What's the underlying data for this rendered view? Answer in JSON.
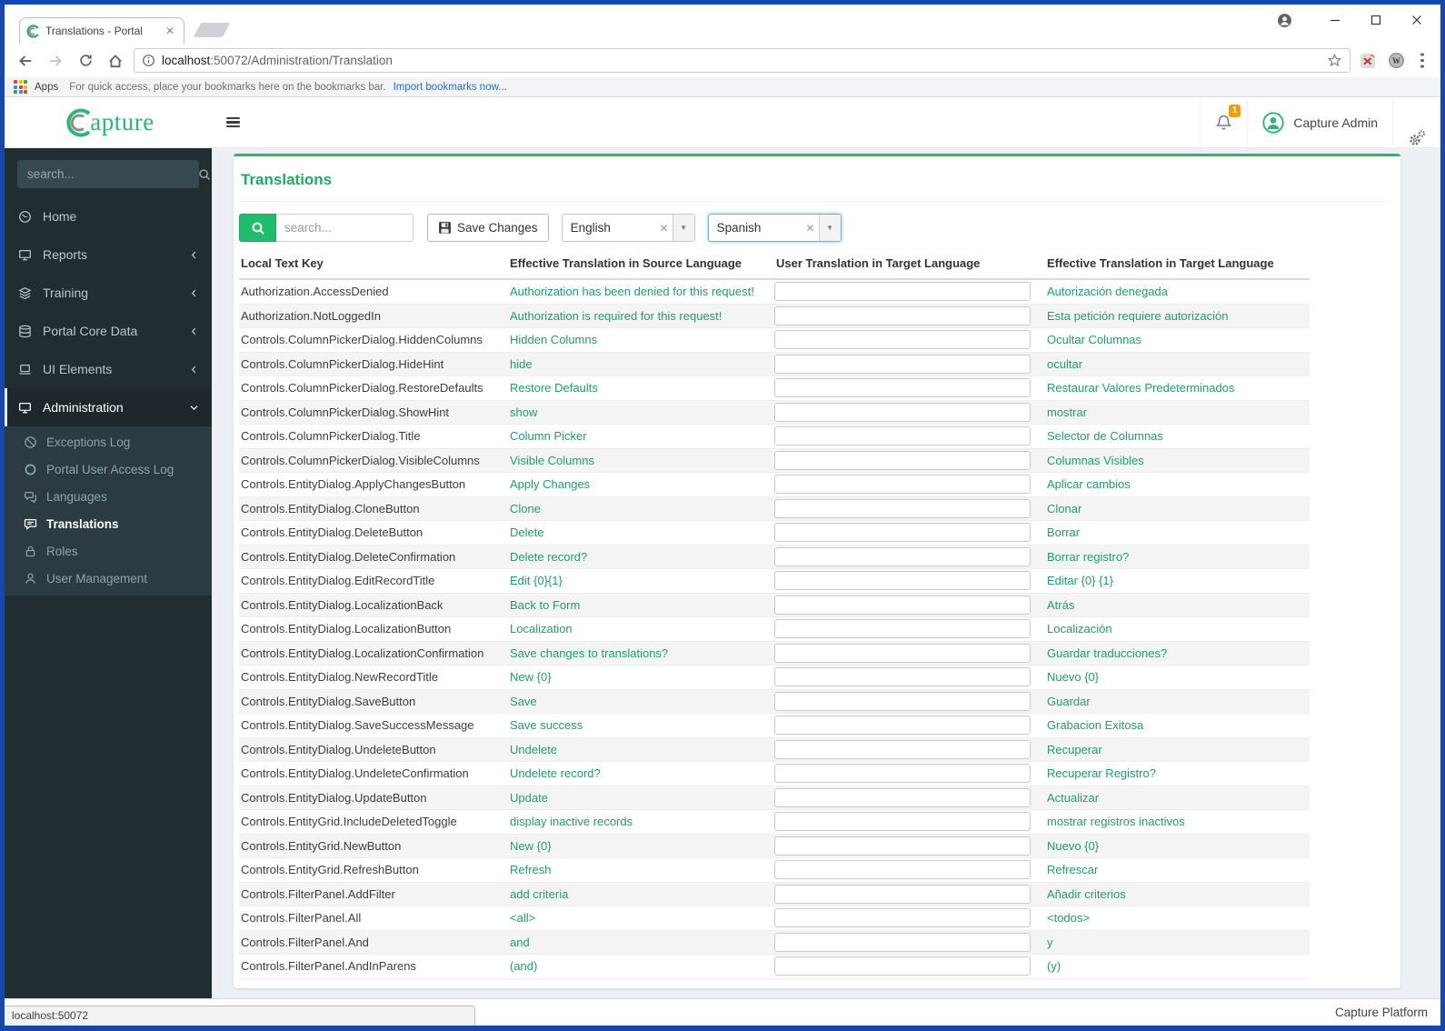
{
  "colors": {
    "frame_blue": "#1547ae",
    "accent_green": "#1fbe6c",
    "text_green": "#1f9e6e",
    "sidebar_bg": "#222d32",
    "badge_orange": "#f39c12",
    "link_blue": "#2b6cd4"
  },
  "browser": {
    "tab_title": "Translations - Portal",
    "url_host": "localhost",
    "url_rest": ":50072/Administration/Translation",
    "bookmarks_apps_label": "Apps",
    "bookmarks_hint": "For quick access, place your bookmarks here on the bookmarks bar.",
    "bookmarks_link": "Import bookmarks now...",
    "status_bubble": "localhost:50072"
  },
  "header": {
    "logo_rest": "apture",
    "user_name": "Capture Admin",
    "notification_count": "1"
  },
  "sidebar": {
    "search_placeholder": "search...",
    "items": [
      {
        "label": "Home",
        "icon": "gauge",
        "chevron": null,
        "active": false
      },
      {
        "label": "Reports",
        "icon": "monitor",
        "chevron": "left",
        "active": false
      },
      {
        "label": "Training",
        "icon": "layers",
        "chevron": "left",
        "active": false
      },
      {
        "label": "Portal Core Data",
        "icon": "database",
        "chevron": "left",
        "active": false
      },
      {
        "label": "UI Elements",
        "icon": "laptop",
        "chevron": "left",
        "active": false
      },
      {
        "label": "Administration",
        "icon": "monitor",
        "chevron": "down",
        "active": true,
        "children": [
          {
            "label": "Exceptions Log",
            "icon": "ban",
            "active": false
          },
          {
            "label": "Portal User Access Log",
            "icon": "circle",
            "active": false
          },
          {
            "label": "Languages",
            "icon": "comments",
            "active": false
          },
          {
            "label": "Translations",
            "icon": "comment-lines",
            "active": true
          },
          {
            "label": "Roles",
            "icon": "lock",
            "active": false
          },
          {
            "label": "User Management",
            "icon": "user",
            "active": false
          }
        ]
      }
    ]
  },
  "main": {
    "title": "Translations",
    "search_placeholder": "search...",
    "save_button_label": "Save Changes",
    "source_language": "English",
    "target_language": "Spanish",
    "table": {
      "columns": [
        "Local Text Key",
        "Effective Translation in Source Language",
        "User Translation in Target Language",
        "Effective Translation in Target Language"
      ],
      "rows": [
        {
          "key": "Authorization.AccessDenied",
          "source": "Authorization has been denied for this request!",
          "user": "",
          "target": "Autorización denegada"
        },
        {
          "key": "Authorization.NotLoggedIn",
          "source": "Authorization is required for this request!",
          "user": "",
          "target": "Esta petición requiere autorización"
        },
        {
          "key": "Controls.ColumnPickerDialog.HiddenColumns",
          "source": "Hidden Columns",
          "user": "",
          "target": "Ocultar Columnas"
        },
        {
          "key": "Controls.ColumnPickerDialog.HideHint",
          "source": "hide",
          "user": "",
          "target": "ocultar"
        },
        {
          "key": "Controls.ColumnPickerDialog.RestoreDefaults",
          "source": "Restore Defaults",
          "user": "",
          "target": "Restaurar Valores Predeterminados"
        },
        {
          "key": "Controls.ColumnPickerDialog.ShowHint",
          "source": "show",
          "user": "",
          "target": "mostrar"
        },
        {
          "key": "Controls.ColumnPickerDialog.Title",
          "source": "Column Picker",
          "user": "",
          "target": "Selector de Columnas"
        },
        {
          "key": "Controls.ColumnPickerDialog.VisibleColumns",
          "source": "Visible Columns",
          "user": "",
          "target": "Columnas Visibles"
        },
        {
          "key": "Controls.EntityDialog.ApplyChangesButton",
          "source": "Apply Changes",
          "user": "",
          "target": "Aplicar cambios"
        },
        {
          "key": "Controls.EntityDialog.CloneButton",
          "source": "Clone",
          "user": "",
          "target": "Clonar"
        },
        {
          "key": "Controls.EntityDialog.DeleteButton",
          "source": "Delete",
          "user": "",
          "target": "Borrar"
        },
        {
          "key": "Controls.EntityDialog.DeleteConfirmation",
          "source": "Delete record?",
          "user": "",
          "target": "Borrar registro?"
        },
        {
          "key": "Controls.EntityDialog.EditRecordTitle",
          "source": "Edit {0}{1}",
          "user": "",
          "target": "Editar {0} {1}"
        },
        {
          "key": "Controls.EntityDialog.LocalizationBack",
          "source": "Back to Form",
          "user": "",
          "target": "Atrás"
        },
        {
          "key": "Controls.EntityDialog.LocalizationButton",
          "source": "Localization",
          "user": "",
          "target": "Localización"
        },
        {
          "key": "Controls.EntityDialog.LocalizationConfirmation",
          "source": "Save changes to translations?",
          "user": "",
          "target": "Guardar traducciones?"
        },
        {
          "key": "Controls.EntityDialog.NewRecordTitle",
          "source": "New {0}",
          "user": "",
          "target": "Nuevo {0}"
        },
        {
          "key": "Controls.EntityDialog.SaveButton",
          "source": "Save",
          "user": "",
          "target": "Guardar"
        },
        {
          "key": "Controls.EntityDialog.SaveSuccessMessage",
          "source": "Save success",
          "user": "",
          "target": "Grabacion Exitosa"
        },
        {
          "key": "Controls.EntityDialog.UndeleteButton",
          "source": "Undelete",
          "user": "",
          "target": "Recuperar"
        },
        {
          "key": "Controls.EntityDialog.UndeleteConfirmation",
          "source": "Undelete record?",
          "user": "",
          "target": "Recuperar Registro?"
        },
        {
          "key": "Controls.EntityDialog.UpdateButton",
          "source": "Update",
          "user": "",
          "target": "Actualizar"
        },
        {
          "key": "Controls.EntityGrid.IncludeDeletedToggle",
          "source": "display inactive records",
          "user": "",
          "target": "mostrar registros inactivos"
        },
        {
          "key": "Controls.EntityGrid.NewButton",
          "source": "New {0}",
          "user": "",
          "target": "Nuevo {0}"
        },
        {
          "key": "Controls.EntityGrid.RefreshButton",
          "source": "Refresh",
          "user": "",
          "target": "Refrescar"
        },
        {
          "key": "Controls.FilterPanel.AddFilter",
          "source": "add criteria",
          "user": "",
          "target": "Añadir criterios"
        },
        {
          "key": "Controls.FilterPanel.All",
          "source": "<all>",
          "user": "",
          "target": "<todos>"
        },
        {
          "key": "Controls.FilterPanel.And",
          "source": "and",
          "user": "",
          "target": "y"
        },
        {
          "key": "Controls.FilterPanel.AndInParens",
          "source": "(and)",
          "user": "",
          "target": "(y)"
        }
      ]
    }
  },
  "footer": {
    "brand": "Capture Platform"
  }
}
